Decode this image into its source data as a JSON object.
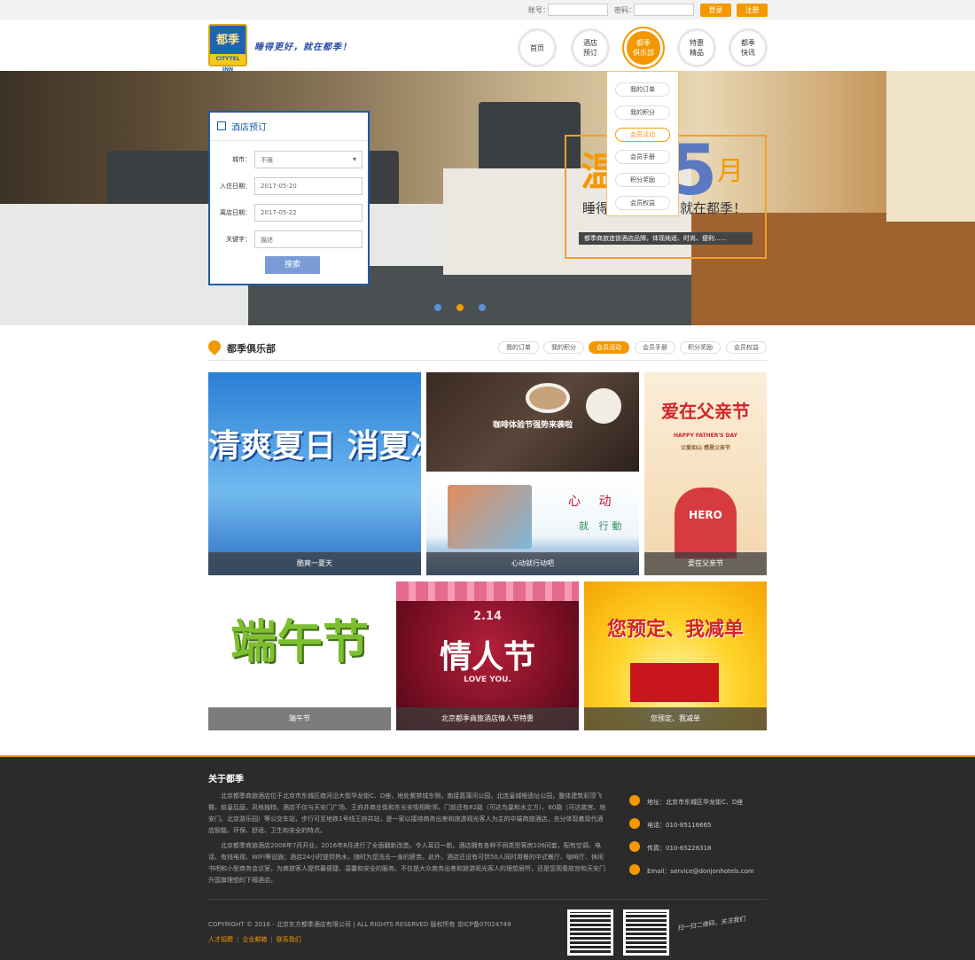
{
  "topbar": {
    "account_label": "账号：",
    "password_label": "密码：",
    "login_label": "登录",
    "register_label": "注册"
  },
  "header": {
    "logo_text": "都季",
    "logo_sub": "CITYTEL INN",
    "slogan": "睡得更好，就在都季！"
  },
  "nav": {
    "items": [
      {
        "line1": "首页",
        "line2": ""
      },
      {
        "line1": "酒店",
        "line2": "预订"
      },
      {
        "line1": "都季",
        "line2": "俱乐部"
      },
      {
        "line1": "特惠",
        "line2": "精品"
      },
      {
        "line1": "都季",
        "line2": "快讯"
      }
    ],
    "active_index": 2
  },
  "dropdown": {
    "items": [
      "我的订单",
      "我的积分",
      "会员活动",
      "会员手册",
      "积分奖励",
      "会员权益"
    ],
    "active_index": 2
  },
  "booking": {
    "title": "酒店预订",
    "city_label": "城市：",
    "city_value": "不限",
    "checkin_label": "入住日期：",
    "checkin_value": "2017-05-20",
    "checkout_label": "离店日期：",
    "checkout_value": "2017-05-22",
    "keyword_label": "关键字：",
    "keyword_placeholder": "描述",
    "search_label": "搜索"
  },
  "promo": {
    "big_left": "温",
    "big_num": "5",
    "big_right": "月",
    "line2_left": "睡得",
    "line2_right": "就在都季！",
    "sub": "都季商旅连锁酒店品牌，体现纯适、时尚、便利……"
  },
  "club": {
    "title": "都季俱乐部",
    "tabs": [
      "我的订单",
      "我的积分",
      "会员活动",
      "会员手册",
      "积分奖励",
      "会员权益"
    ],
    "active_index": 2
  },
  "tiles": {
    "t1": {
      "caption": "酷爽一夏天",
      "art": "清爽夏日 消夏冰饮"
    },
    "t2": {
      "caption": "",
      "art": "咖啡体验节强势来袭啦"
    },
    "t3": {
      "caption": "心动就行动吧",
      "art_a": "心 动",
      "art_b": "就 行動"
    },
    "t4": {
      "caption": "爱在父亲节",
      "art": "爱在父亲节",
      "art_sub": "HAPPY FATHER'S DAY",
      "art_sub2": "父爱如山 感恩父亲节",
      "art_hero": "HERO"
    },
    "t5": {
      "caption": "端午节",
      "art": "端午节"
    },
    "t6": {
      "caption": "北京都季商旅酒店情人节特惠",
      "art": "情人节",
      "art_date": "2.14",
      "art_sub": "LOVE YOU."
    },
    "t7": {
      "caption": "您预定、我减单",
      "art": "您预定、我减单"
    }
  },
  "footer": {
    "title": "关于都季",
    "para1": "北京都季商旅酒店位于北京市东城区南河沿大街华龙街C、D座，地处紫禁城东侧，南接菖蒲河公园，北连皇城根遗址公园，整体建筑彩顶飞檐，前皇后庭，风格独特。酒店不仅与天安门广场、王府井商业街和东长安街相毗邻，门前还有82路（可达鸟巢和水立方）、60路（可达故宫、地安门、北京游乐园）等公交车站，步行可至地铁1号线王府井站，是一家以接待商务出差和旅游观光客人为主的中端商旅酒店，充分体现着现代酒店智能、环保、舒适、卫生和安全的特点。",
    "para2": "北京都季商旅酒店2008年7月开业，2016年8月进行了全面翻新改造，令人耳目一新。酒店拥有各种不同类型客房106间套，配有空调、电话、有线电视、WIFI等设施；酒店24小时提供热水，随时为您洗去一身的疲劳。此外，酒店还设有可供50人同时用餐的中式餐厅、咖啡厅、休闲书吧和小型商务会议室，为商旅客人提供最便捷、温馨和安全的服务。不仅是大众商务出差和旅游观光客人的理想居所，还是您观看故宫和天安门升国旗理想的下榻酒店。",
    "address": "地址：北京市东城区华龙街C、D座",
    "phone": "电话：010-85116665",
    "fax": "传真：010-65226318",
    "email": "Email：service@donjonhotels.com",
    "copyright": "COPYRIGHT © 2016 - 北京东方都季酒店有限公司  | ALL RIGHTS RESERVED     版权所有 京ICP备07024749",
    "links": [
      "人才招聘",
      "企业邮箱",
      "联系我们"
    ],
    "scan_text": "扫一扫二维码，关注我们"
  },
  "colors": {
    "accent": "#f39800",
    "brand_blue": "#1f5aa6",
    "footer_bg": "#2b2b2b"
  }
}
